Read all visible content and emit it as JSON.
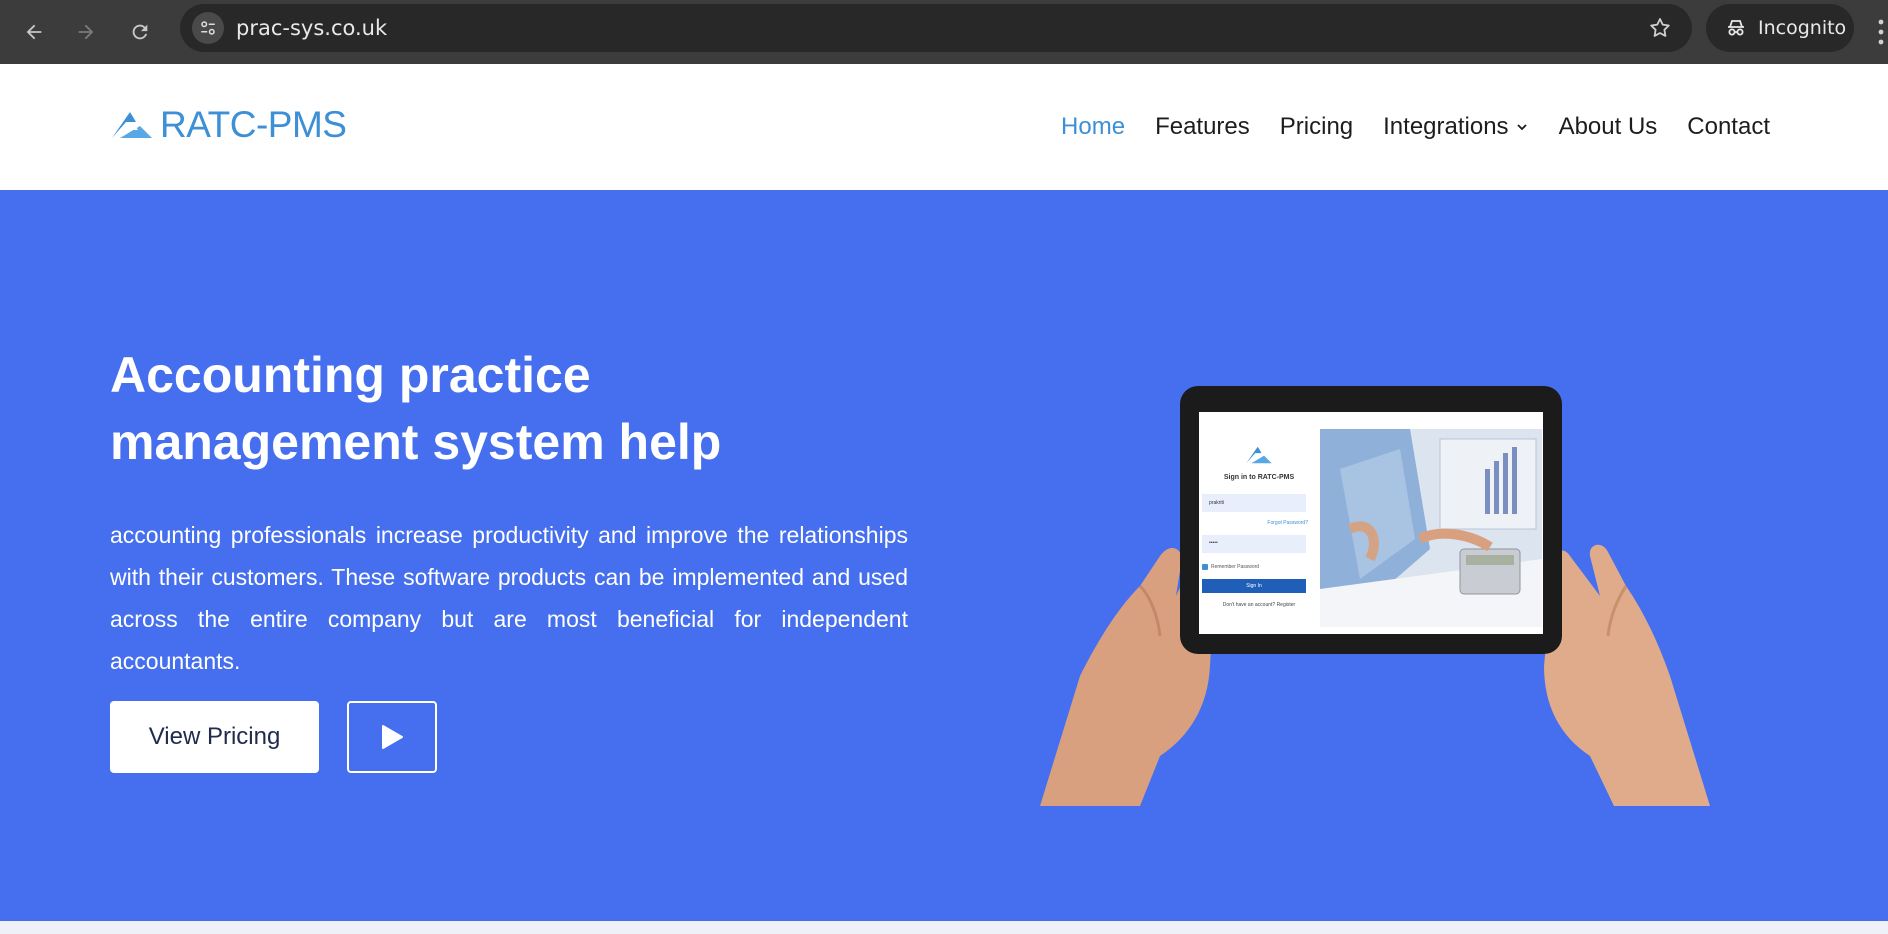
{
  "browser": {
    "url": "prac-sys.co.uk",
    "profile_label": "Incognito"
  },
  "site": {
    "logo_text": "RATC-PMS",
    "nav": [
      {
        "label": "Home",
        "active": true
      },
      {
        "label": "Features"
      },
      {
        "label": "Pricing"
      },
      {
        "label": "Integrations",
        "has_dropdown": true
      },
      {
        "label": "About Us"
      },
      {
        "label": "Contact"
      }
    ]
  },
  "hero": {
    "title_line1": "Accounting practice",
    "title_line2": "management system help",
    "description": "accounting professionals increase productivity and improve the relationships with their customers. These software products can be implemented and used across the entire company but are most beneficial for independent accountants.",
    "primary_button": "View Pricing",
    "play_button_icon": "play-icon",
    "background_color": "#456fee"
  },
  "tablet_screen": {
    "title": "Sign in to RATC-PMS",
    "username_value": "prakriti",
    "forgot_link": "Forgot Password?",
    "password_value": "•••••",
    "remember_label": "Remember Password",
    "signin_button": "Sign In",
    "register_text": "Don't have an account? Register"
  },
  "colors": {
    "brand_blue": "#3d8fd6",
    "hero_blue": "#456fee",
    "chrome_dark": "#3c3c3c"
  }
}
